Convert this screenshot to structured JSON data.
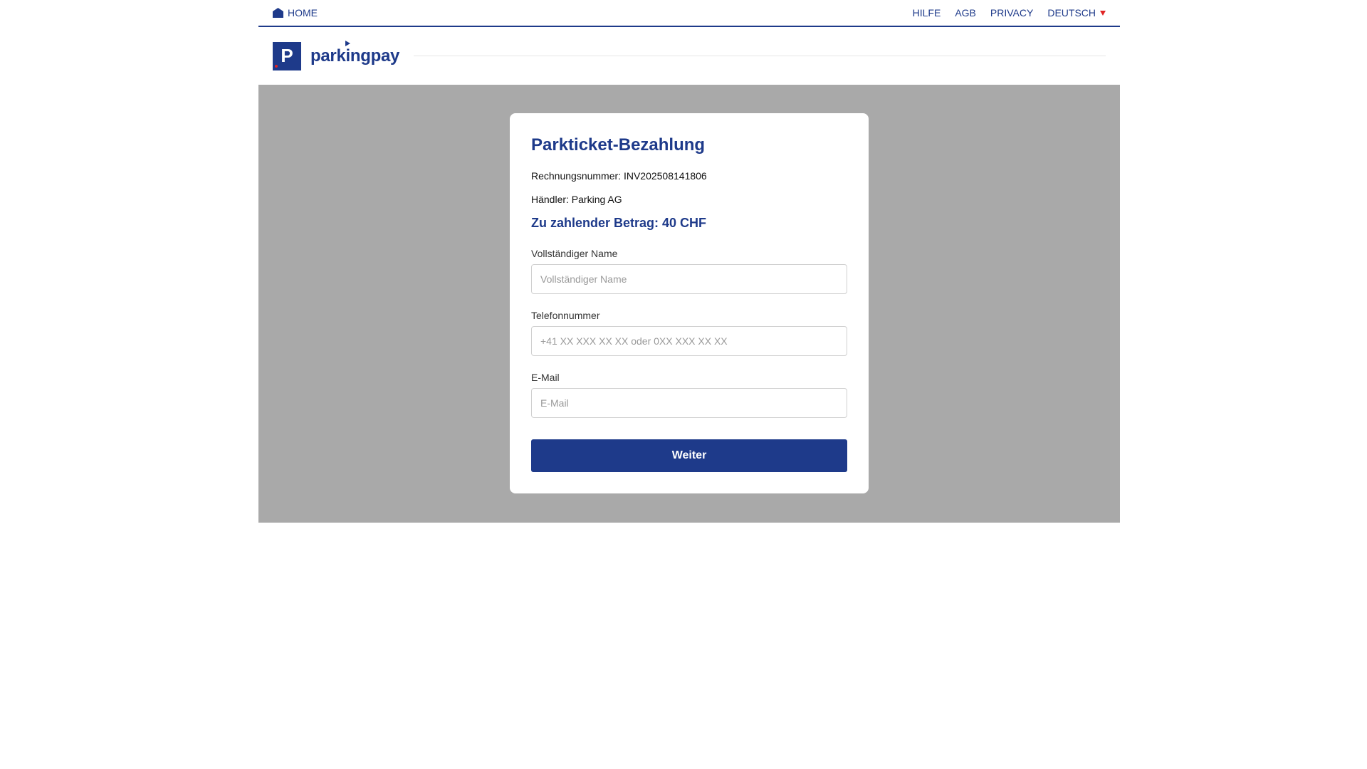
{
  "nav": {
    "home_label": "HOME",
    "links": {
      "help": "HILFE",
      "terms": "AGB",
      "privacy": "PRIVACY"
    },
    "language": "DEUTSCH"
  },
  "brand": {
    "logo_letter": "P",
    "name": "parkingpay"
  },
  "form": {
    "title": "Parkticket-Bezahlung",
    "invoice_label": "Rechnungsnummer: INV202508141806",
    "merchant_label": "Händler: Parking AG",
    "amount_label": "Zu zahlender Betrag: 40 CHF",
    "name": {
      "label": "Vollständiger Name",
      "placeholder": "Vollständiger Name",
      "value": ""
    },
    "phone": {
      "label": "Telefonnummer",
      "placeholder": "+41 XX XXX XX XX oder 0XX XXX XX XX",
      "value": ""
    },
    "email": {
      "label": "E-Mail",
      "placeholder": "E-Mail",
      "value": ""
    },
    "submit_label": "Weiter"
  },
  "colors": {
    "brand": "#1e3a8a",
    "accent": "#e02424",
    "overlay": "#a9a9a9"
  },
  "icons": {
    "home": "home-icon",
    "language_caret": "caret-down-icon"
  }
}
